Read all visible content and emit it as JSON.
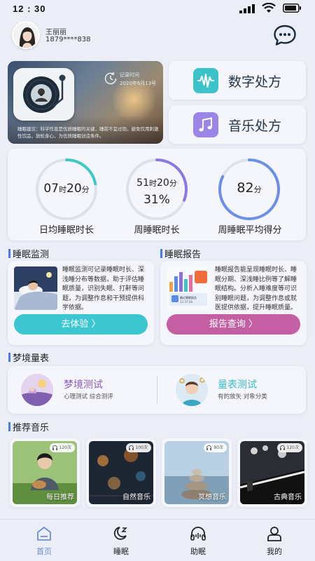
{
  "status_bar": {
    "time": "12 : 30"
  },
  "user": {
    "name": "王丽丽",
    "phone": "1879****838"
  },
  "hero": {
    "record_label": "记录时间",
    "record_date": "2020年6月13号",
    "advice": "睡眠建议：科学作息是优质睡眠的关键，睡前不宜过饱，避免饮用刺激性饮品，放松身心，为优质睡眠创造条件。"
  },
  "prescriptions": [
    {
      "label": "数字处方",
      "icon": "waveform-icon",
      "color": "#3cc3c9"
    },
    {
      "label": "音乐处方",
      "icon": "music-note-icon",
      "color": "#9b86e8"
    }
  ],
  "stats": [
    {
      "h": "07",
      "h_unit": "时",
      "m": "20",
      "m_unit": "分",
      "label": "日均睡眠时长",
      "progress": 0.22,
      "color": "#3ec9c6"
    },
    {
      "h": "51",
      "h_unit": "时",
      "m": "20",
      "m_unit": "分",
      "pct": "31%",
      "label": "周睡眠时长",
      "progress": 0.31,
      "color": "#8b78e2"
    },
    {
      "score": "82",
      "score_unit": "分",
      "label": "周睡眠平均得分",
      "progress": 0.82,
      "color": "#6d8fe6"
    }
  ],
  "sleep_monitor": {
    "title": "睡眠监测",
    "desc": "睡眠监测可记录睡眠时长、深浅睡分布等数据，助于评估睡眠质量，识别失眠、打鼾等问题，为调整作息和干预提供科学依据。",
    "button": "去体验  〉",
    "button_color": "#3cc6cf"
  },
  "sleep_report": {
    "title": "睡眠报告",
    "desc": "睡眠报告能呈现睡眠时长、睡眠分期、深浅睡比例等了解睡眠结构。分析入睡难度等可识别睡眠问题，为调整作息或就医提供依据，提升睡眠质量。",
    "button": "报告查询  〉",
    "button_color": "#c45fa3",
    "mini_title": "最近睡眠报告",
    "mini_date": "12:37:28"
  },
  "dream": {
    "title": "梦境量表",
    "items": [
      {
        "title": "梦境测试",
        "sub": "心理测试  综合测评",
        "color": "#8c5cb8"
      },
      {
        "title": "量表测试",
        "sub": "有的放矢  对象分类",
        "color": "#3bbcc9"
      }
    ]
  },
  "music": {
    "title": "推荐音乐",
    "items": [
      {
        "label": "每日推荐",
        "count": "120次"
      },
      {
        "label": "自然音乐",
        "count": "100次"
      },
      {
        "label": "冥想音乐",
        "count": "80次"
      },
      {
        "label": "古典音乐",
        "count": "120次"
      }
    ]
  },
  "tabs": [
    {
      "label": "首页",
      "icon": "home-icon",
      "active": true
    },
    {
      "label": "睡眠",
      "icon": "sleep-moon-icon",
      "active": false
    },
    {
      "label": "助眠",
      "icon": "headphones-icon",
      "active": false
    },
    {
      "label": "我的",
      "icon": "profile-icon",
      "active": false
    }
  ]
}
